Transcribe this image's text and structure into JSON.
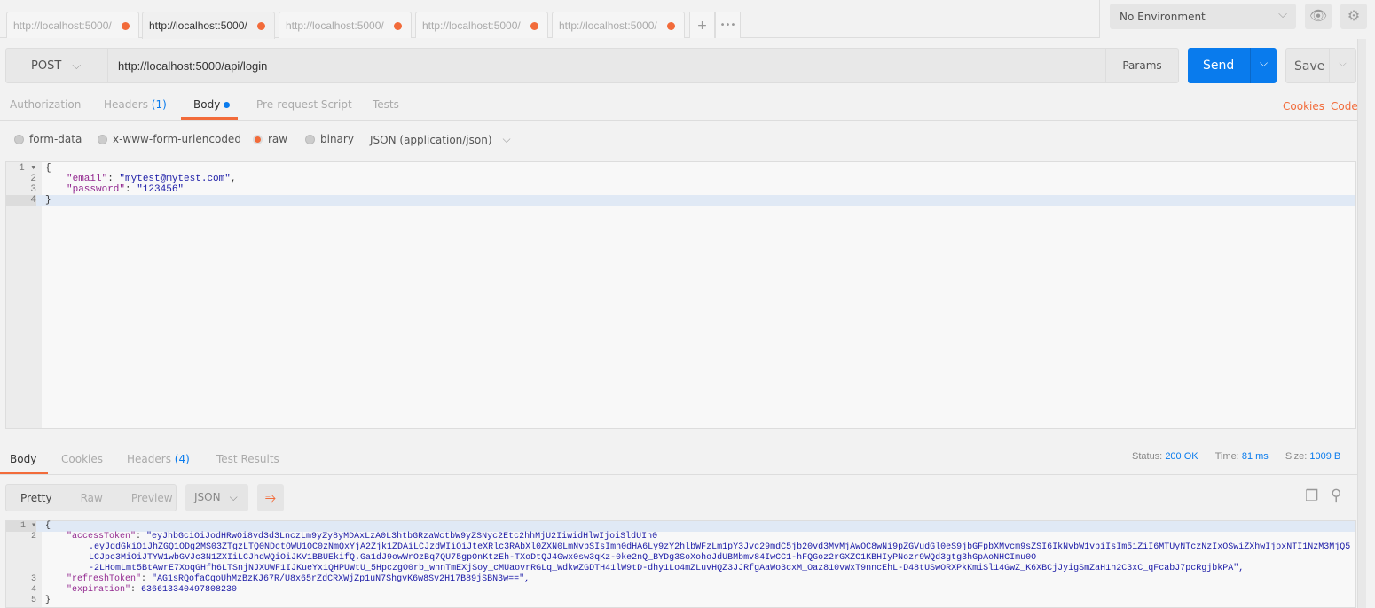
{
  "tabs": [
    {
      "label": "http://localhost:5000/",
      "active": false
    },
    {
      "label": "http://localhost:5000/",
      "active": true
    },
    {
      "label": "http://localhost:5000/",
      "active": false
    },
    {
      "label": "http://localhost:5000/",
      "active": false
    },
    {
      "label": "http://localhost:5000/",
      "active": false
    }
  ],
  "tab_actions": {
    "add": "+",
    "more": "•••"
  },
  "environment": {
    "selected": "No Environment"
  },
  "request": {
    "method": "POST",
    "url": "http://localhost:5000/api/login",
    "params": "Params",
    "send": "Send",
    "save": "Save"
  },
  "request_tabs": {
    "authorization": "Authorization",
    "headers": "Headers",
    "headers_count": "(1)",
    "body": "Body",
    "prerequest": "Pre-request Script",
    "tests": "Tests",
    "cookies": "Cookies",
    "code": "Code"
  },
  "body_modes": {
    "form_data": "form-data",
    "urlencoded": "x-www-form-urlencoded",
    "raw": "raw",
    "binary": "binary",
    "content_type": "JSON (application/json)",
    "selected": "raw"
  },
  "request_body": {
    "open": "{",
    "close": "}",
    "email_key": "\"email\"",
    "email_val": "\"mytest@mytest.com\"",
    "password_key": "\"password\"",
    "password_val": "\"123456\""
  },
  "response_tabs": {
    "body": "Body",
    "cookies": "Cookies",
    "headers": "Headers",
    "headers_count": "(4)",
    "test_results": "Test Results"
  },
  "response_meta": {
    "status_label": "Status:",
    "status": "200 OK",
    "time_label": "Time:",
    "time": "81 ms",
    "size_label": "Size:",
    "size": "1009 B"
  },
  "response_view": {
    "pretty": "Pretty",
    "raw": "Raw",
    "preview": "Preview",
    "format": "JSON"
  },
  "response_body": {
    "open": "{",
    "close": "}",
    "access_key": "\"accessToken\"",
    "access_1": "\"eyJhbGciOiJodHRwOi8vd3d3LnczLm9yZy8yMDAxLzA0L3htbGRzaWctbW9yZSNyc2Etc2hhMjU2IiwidHlwIjoiSldUIn0",
    "access_2": ".eyJqdGkiOiJhZGQ1ODg2MS03ZTgzLTQ0NDctOWU1OC0zNmQxYjA2Zjk1ZDAiLCJzdWIiOiJteXRlc3RAbXl0ZXN0LmNvbSIsImh0dHA6Ly9zY2hlbWFzLm1pY3Jvc29mdC5jb20vd3MvMjAwOC8wNi9pZGVudGl0eS9jbGFpbXMvcm9sZSI6IkNvbW1vbiIsIm5iZiI6MTUyNTczNzIxOSwiZXhwIjoxNTI1NzM3MjQ5",
    "access_3": "LCJpc3MiOiJTYW1wbGVJc3N1ZXIiLCJhdWQiOiJKV1BBUEkifQ.Ga1dJ9owWrOzBq7QU75gpOnKtzEh-TXoDtQJ4Gwx0sw3qKz-0ke2nQ_BYDg3SoXohoJdUBMbmv84IwCC1-hFQGoz2rGXZC1KBHIyPNozr9WQd3gtg3hGpAoNHCImu0O",
    "access_4": "-2LHomLmt5BtAwrE7XoqGHfh6LTSnjNJXUWF1IJKueYx1QHPUWtU_5HpczgO0rb_whnTmEXjSoy_cMUaovrRGLq_WdkwZGDTH41lW9tD-dhy1Lo4mZLuvHQZ3JJRfgAaWo3cxM_Oaz810vWxT9nncEhL-D48tUSwORXPkKmiSl14GwZ_K6XBCjJyigSmZaH1h2C3xC_qFcabJ7pcRgjbkPA\",",
    "refresh_key": "\"refreshToken\"",
    "refresh_val": "\"AG1sRQofaCqoUhMzBzKJ67R/U8x65rZdCRXWjZp1uN7ShgvK6w8Sv2H17B89jSBN3w==\",",
    "expiration_key": "\"expiration\"",
    "expiration_val": "636613340497808230"
  },
  "colors": {
    "accent": "#f26b3a",
    "primary": "#097bed"
  }
}
